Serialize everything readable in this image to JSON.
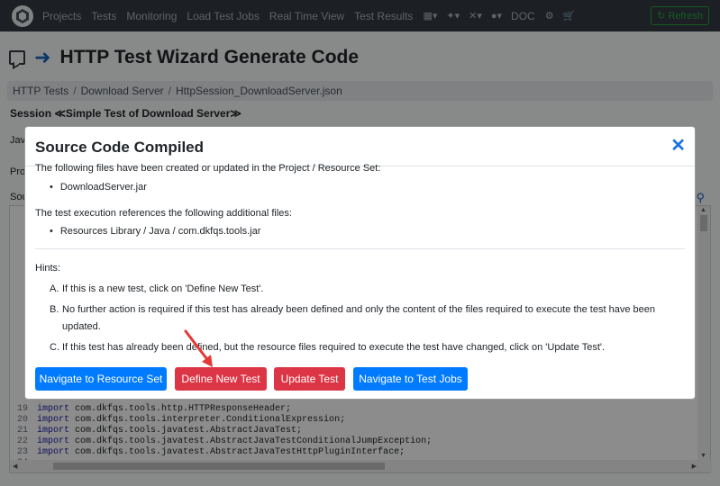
{
  "navbar": {
    "links": [
      "Projects",
      "Tests",
      "Monitoring",
      "Load Test Jobs",
      "Real Time View",
      "Test Results"
    ],
    "doc": "DOC",
    "refresh": "Refresh"
  },
  "page": {
    "title": "HTTP Test Wizard Generate Code",
    "breadcrumb": [
      "HTTP Tests",
      "Download Server",
      "HttpSession_DownloadServer.json"
    ],
    "session": "Session ≪Simple Test of Download Server≫",
    "labels": [
      "Jav",
      "Pro",
      "Sou"
    ]
  },
  "code": [
    {
      "ln": "19",
      "kw": "import",
      "pkg": "com.dkfqs.tools.http.HTTPResponseHeader;"
    },
    {
      "ln": "20",
      "kw": "import",
      "pkg": "com.dkfqs.tools.interpreter.ConditionalExpression;"
    },
    {
      "ln": "21",
      "kw": "import",
      "pkg": "com.dkfqs.tools.javatest.AbstractJavaTest;"
    },
    {
      "ln": "22",
      "kw": "import",
      "pkg": "com.dkfqs.tools.javatest.AbstractJavaTestConditionalJumpException;"
    },
    {
      "ln": "23",
      "kw": "import",
      "pkg": "com.dkfqs.tools.javatest.AbstractJavaTestHttpPluginInterface;"
    },
    {
      "ln": "24",
      "kw": "",
      "pkg": ""
    }
  ],
  "modal": {
    "title": "Source Code Compiled",
    "intro": "The following files have been created or updated in the Project / Resource Set:",
    "created_files": [
      "DownloadServer.jar"
    ],
    "refs_intro": "The test execution references the following additional files:",
    "ref_files": [
      "Resources Library / Java / com.dkfqs.tools.jar"
    ],
    "hints_label": "Hints:",
    "hints": [
      {
        "letter": "A.",
        "text": "If this is a new test, click on 'Define New Test'."
      },
      {
        "letter": "B.",
        "text": "No further action is required if this test has already been defined and only the content of the files required to execute the test have been updated."
      },
      {
        "letter": "C.",
        "text": "If this test has already been defined, but the resource files required to execute the test have changed, click on 'Update Test'."
      }
    ],
    "buttons": {
      "nav_resource": "Navigate to Resource Set",
      "define": "Define New Test",
      "update": "Update Test",
      "nav_jobs": "Navigate to Test Jobs"
    }
  },
  "colors": {
    "navbar": "#343a40",
    "primary": "#007bff",
    "danger": "#dc3545",
    "annotation_arrow": "#e53935"
  }
}
